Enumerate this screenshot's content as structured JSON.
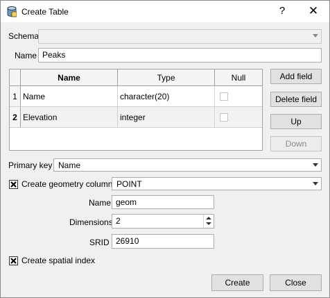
{
  "window": {
    "title": "Create Table",
    "help": "?",
    "close": "✕"
  },
  "schema": {
    "label": "Schema",
    "value": ""
  },
  "name": {
    "label": "Name",
    "value": "Peaks"
  },
  "fields_table": {
    "headers": [
      "Name",
      "Type",
      "Null"
    ],
    "rows": [
      {
        "num": "1",
        "name": "Name",
        "type": "character(20)",
        "null": false
      },
      {
        "num": "2",
        "name": "Elevation",
        "type": "integer",
        "null": false
      }
    ]
  },
  "buttons": {
    "add_field": "Add field",
    "delete_field": "Delete field",
    "up": "Up",
    "down": "Down",
    "create": "Create",
    "close": "Close"
  },
  "primary_key": {
    "label": "Primary key",
    "value": "Name"
  },
  "geometry": {
    "checkbox_label": "Create geometry column",
    "checked": true,
    "type_value": "POINT",
    "name_label": "Name",
    "name_value": "geom",
    "dimensions_label": "Dimensions",
    "dimensions_value": "2",
    "srid_label": "SRID",
    "srid_value": "26910"
  },
  "spatial_index": {
    "label": "Create spatial index",
    "checked": true
  }
}
